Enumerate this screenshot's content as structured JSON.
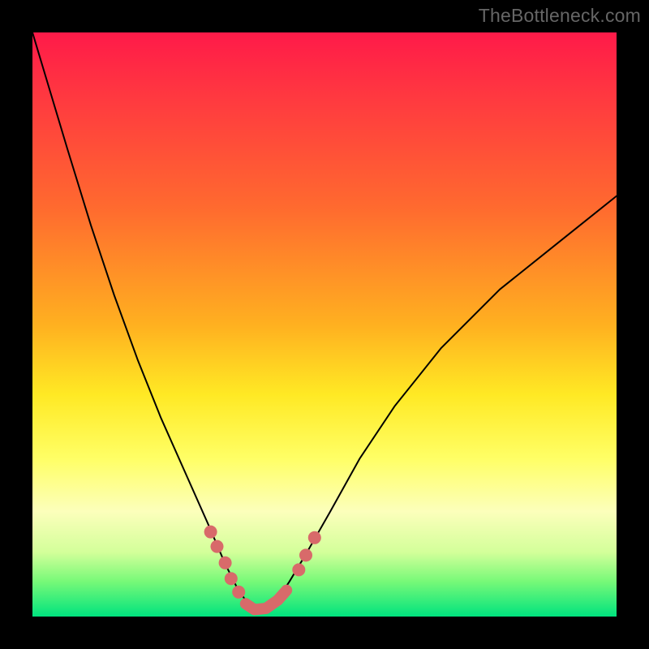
{
  "attribution": "TheBottleneck.com",
  "chart_data": {
    "type": "line",
    "title": "",
    "xlabel": "",
    "ylabel": "",
    "xlim": [
      0,
      100
    ],
    "ylim": [
      0,
      100
    ],
    "grid": false,
    "legend": false,
    "note": "V-shaped bottleneck curve over a red→green vertical gradient; minimum near x≈38; curve rises steeply to ~100 at x=0 and to ~72 at x=100.",
    "series": [
      {
        "name": "bottleneck-curve",
        "x": [
          0,
          3,
          6,
          10,
          14,
          18,
          22,
          26,
          30,
          33,
          35,
          37,
          38.5,
          40,
          42,
          44,
          47,
          51,
          56,
          62,
          70,
          80,
          90,
          100
        ],
        "values": [
          100,
          90,
          80,
          67,
          55,
          44,
          34,
          25,
          16,
          9,
          5,
          2,
          1,
          1.5,
          3,
          6,
          11,
          18,
          27,
          36,
          46,
          56,
          64,
          72
        ]
      }
    ],
    "markers": {
      "name": "highlighted-points",
      "comment": "salmon dots near the valley on both slopes + bottom run",
      "left_slope": [
        [
          30.5,
          14.5
        ],
        [
          31.6,
          12
        ],
        [
          33,
          9.2
        ],
        [
          34,
          6.5
        ],
        [
          35.3,
          4.2
        ]
      ],
      "bottom_run": [
        [
          36.5,
          2.2
        ],
        [
          38,
          1.2
        ],
        [
          40,
          1.4
        ],
        [
          42,
          2.8
        ],
        [
          43.5,
          4.5
        ]
      ],
      "right_slope": [
        [
          45.6,
          8
        ],
        [
          46.8,
          10.5
        ],
        [
          48.3,
          13.5
        ]
      ]
    },
    "gradient_stops": [
      {
        "pct": 0,
        "color": "#ff1a49"
      },
      {
        "pct": 12,
        "color": "#ff3b3f"
      },
      {
        "pct": 30,
        "color": "#ff6a2f"
      },
      {
        "pct": 50,
        "color": "#ffb020"
      },
      {
        "pct": 62,
        "color": "#ffe924"
      },
      {
        "pct": 73,
        "color": "#ffff66"
      },
      {
        "pct": 82,
        "color": "#fcffbb"
      },
      {
        "pct": 89,
        "color": "#d3ff9a"
      },
      {
        "pct": 94,
        "color": "#77f978"
      },
      {
        "pct": 100,
        "color": "#00e37e"
      }
    ]
  }
}
